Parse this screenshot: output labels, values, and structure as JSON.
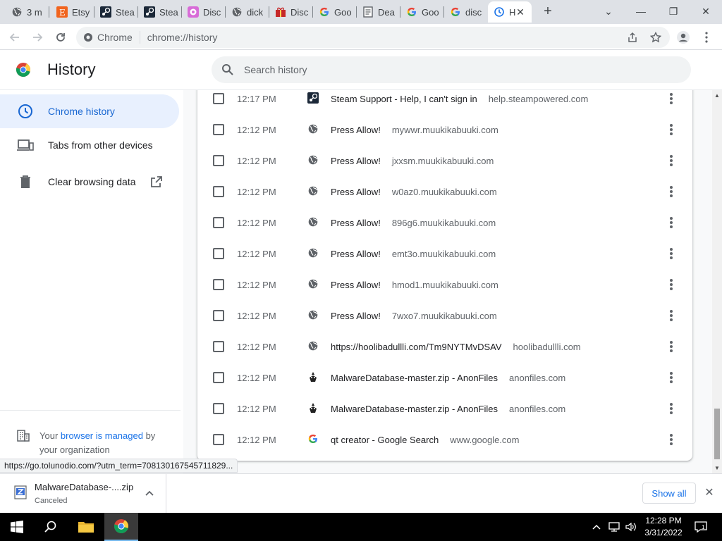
{
  "tabs": [
    {
      "label": "3 m",
      "icon": "globe-icon"
    },
    {
      "label": "Etsy",
      "icon": "etsy-icon"
    },
    {
      "label": "Stea",
      "icon": "steam-icon"
    },
    {
      "label": "Stea",
      "icon": "steam-icon"
    },
    {
      "label": "Disc",
      "icon": "discord-icon"
    },
    {
      "label": "dick",
      "icon": "globe-icon"
    },
    {
      "label": "Disc",
      "icon": "gift-icon"
    },
    {
      "label": "Goo",
      "icon": "google-icon"
    },
    {
      "label": "Dea",
      "icon": "document-icon"
    },
    {
      "label": "Goo",
      "icon": "google-icon"
    },
    {
      "label": "disc",
      "icon": "google-icon"
    },
    {
      "label": "H",
      "icon": "history-icon",
      "active": true
    }
  ],
  "omnibox": {
    "chip": "Chrome",
    "url": "chrome://history"
  },
  "header": {
    "title": "History",
    "search_placeholder": "Search history"
  },
  "sidebar": {
    "items": [
      {
        "label": "Chrome history",
        "icon": "clock-icon",
        "active": true
      },
      {
        "label": "Tabs from other devices",
        "icon": "devices-icon"
      },
      {
        "label": "Clear browsing data",
        "icon": "trash-icon"
      }
    ],
    "managed": {
      "pre": "Your ",
      "link": "browser is managed",
      "post": " by your organization"
    }
  },
  "history": [
    {
      "time": "12:17 PM",
      "title": "Steam Support - Help, I can't sign in",
      "domain": "help.steampowered.com",
      "icon": "steam-icon"
    },
    {
      "time": "12:12 PM",
      "title": "Press Allow!",
      "domain": "mywwr.muukikabuuki.com",
      "icon": "globe-icon"
    },
    {
      "time": "12:12 PM",
      "title": "Press Allow!",
      "domain": "jxxsm.muukikabuuki.com",
      "icon": "globe-icon"
    },
    {
      "time": "12:12 PM",
      "title": "Press Allow!",
      "domain": "w0az0.muukikabuuki.com",
      "icon": "globe-icon"
    },
    {
      "time": "12:12 PM",
      "title": "Press Allow!",
      "domain": "896g6.muukikabuuki.com",
      "icon": "globe-icon"
    },
    {
      "time": "12:12 PM",
      "title": "Press Allow!",
      "domain": "emt3o.muukikabuuki.com",
      "icon": "globe-icon"
    },
    {
      "time": "12:12 PM",
      "title": "Press Allow!",
      "domain": "hmod1.muukikabuuki.com",
      "icon": "globe-icon"
    },
    {
      "time": "12:12 PM",
      "title": "Press Allow!",
      "domain": "7wxo7.muukikabuuki.com",
      "icon": "globe-icon"
    },
    {
      "time": "12:12 PM",
      "title": "https://hoolibadullli.com/Tm9NYTMvDSAV",
      "domain": "hoolibadullli.com",
      "icon": "globe-icon"
    },
    {
      "time": "12:12 PM",
      "title": "MalwareDatabase-master.zip - AnonFiles",
      "domain": "anonfiles.com",
      "icon": "anonfiles-icon"
    },
    {
      "time": "12:12 PM",
      "title": "MalwareDatabase-master.zip - AnonFiles",
      "domain": "anonfiles.com",
      "icon": "anonfiles-icon"
    },
    {
      "time": "12:12 PM",
      "title": "qt creator - Google Search",
      "domain": "www.google.com",
      "icon": "google-icon"
    }
  ],
  "status_url": "https://go.tolunodio.com/?utm_term=708130167545711829...",
  "download": {
    "filename": "MalwareDatabase-....zip",
    "status": "Canceled",
    "show_all": "Show all"
  },
  "clock": {
    "time": "12:28 PM",
    "date": "3/31/2022"
  },
  "colors": {
    "accent": "#1a73e8",
    "active_bg": "#e8f0fe",
    "tabstrip": "#dee1e6"
  }
}
